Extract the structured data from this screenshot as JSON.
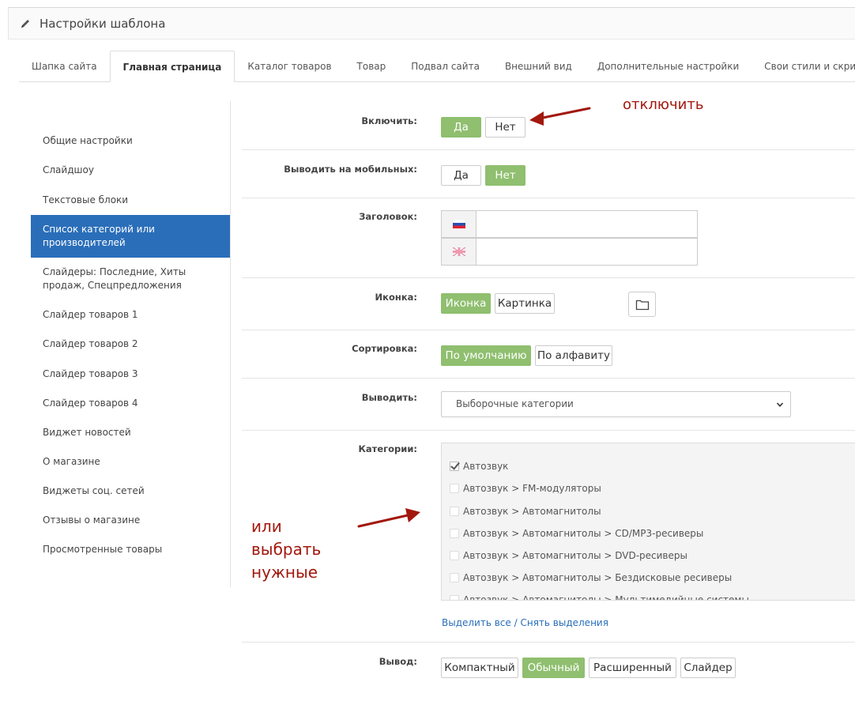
{
  "header": {
    "title": "Настройки шаблона"
  },
  "tabs": [
    {
      "label": "Шапка сайта"
    },
    {
      "label": "Главная страница"
    },
    {
      "label": "Каталог товаров"
    },
    {
      "label": "Товар"
    },
    {
      "label": "Подвал сайта"
    },
    {
      "label": "Внешний вид"
    },
    {
      "label": "Дополнительные настройки"
    },
    {
      "label": "Свои стили и скрипты"
    }
  ],
  "sidebar": {
    "items": [
      {
        "label": "Общие настройки"
      },
      {
        "label": "Слайдшоу"
      },
      {
        "label": "Текстовые блоки"
      },
      {
        "label": "Список категорий или производителей"
      },
      {
        "label": "Слайдеры: Последние, Хиты продаж, Спецпредложения"
      },
      {
        "label": "Слайдер товаров 1"
      },
      {
        "label": "Слайдер товаров 2"
      },
      {
        "label": "Слайдер товаров 3"
      },
      {
        "label": "Слайдер товаров 4"
      },
      {
        "label": "Виджет новостей"
      },
      {
        "label": "О магазине"
      },
      {
        "label": "Виджеты соц. сетей"
      },
      {
        "label": "Отзывы о магазине"
      },
      {
        "label": "Просмотренные товары"
      }
    ]
  },
  "form": {
    "enable": {
      "label": "Включить:",
      "yes": "Да",
      "no": "Нет"
    },
    "mobile": {
      "label": "Выводить на мобильных:",
      "yes": "Да",
      "no": "Нет"
    },
    "heading": {
      "label": "Заголовок:",
      "value_ru": "",
      "value_en": ""
    },
    "icon": {
      "label": "Иконка:",
      "opt_icon": "Иконка",
      "opt_image": "Картинка"
    },
    "sort": {
      "label": "Сортировка:",
      "opt_default": "По умолчанию",
      "opt_alpha": "По алфавиту"
    },
    "display": {
      "label": "Выводить:",
      "selected": "Выборочные категории"
    },
    "categories": {
      "label": "Категории:",
      "items": [
        {
          "text": "Автозвук",
          "checked": true
        },
        {
          "text": "Автозвук  >  FM-модуляторы",
          "checked": false
        },
        {
          "text": "Автозвук  >  Автомагнитолы",
          "checked": false
        },
        {
          "text": "Автозвук  >  Автомагнитолы  >  CD/MP3-ресиверы",
          "checked": false
        },
        {
          "text": "Автозвук  >  Автомагнитолы  >  DVD-ресиверы",
          "checked": false
        },
        {
          "text": "Автозвук  >  Автомагнитолы  >  Бездисковые ресиверы",
          "checked": false
        },
        {
          "text": "Автозвук  >  Автомагнитолы  >  Мультимедийные системы",
          "checked": false
        }
      ],
      "select_all": "Выделить все",
      "separator": " / ",
      "deselect": "Снять выделения"
    },
    "view": {
      "label": "Вывод:",
      "opt_compact": "Компактный",
      "opt_normal": "Обычный",
      "opt_extended": "Расширенный",
      "opt_slider": "Слайдер"
    }
  },
  "annotations": {
    "disable": "отключить",
    "or_choose_1": "или",
    "or_choose_2": "выбрать",
    "or_choose_3": "нужные"
  },
  "colors": {
    "active_nav": "#2a6eb9",
    "toggle_on": "#8fbf6f",
    "annotation": "#a2180d"
  }
}
